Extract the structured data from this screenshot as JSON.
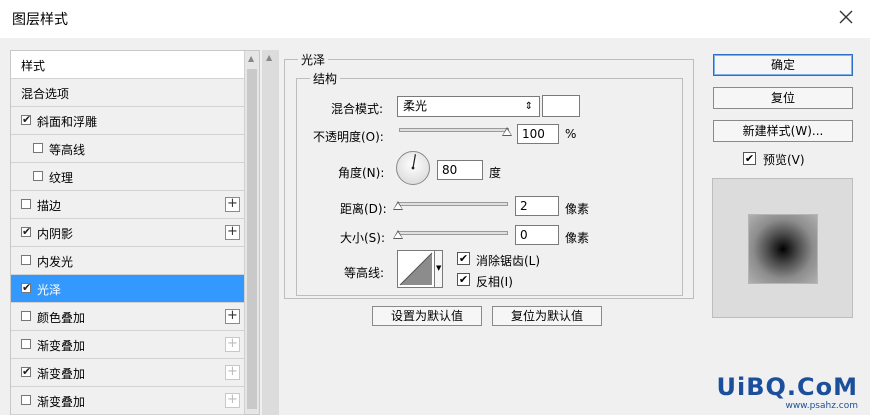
{
  "window": {
    "title": "图层样式"
  },
  "style_list": {
    "items": [
      {
        "label": "样式",
        "checkbox": false,
        "checked": false,
        "plus": "none",
        "indent": false,
        "selected": false
      },
      {
        "label": "混合选项",
        "checkbox": false,
        "checked": false,
        "plus": "none",
        "indent": false,
        "selected": false
      },
      {
        "label": "斜面和浮雕",
        "checkbox": true,
        "checked": true,
        "plus": "none",
        "indent": false,
        "selected": false
      },
      {
        "label": "等高线",
        "checkbox": true,
        "checked": false,
        "plus": "none",
        "indent": true,
        "selected": false
      },
      {
        "label": "纹理",
        "checkbox": true,
        "checked": false,
        "plus": "none",
        "indent": true,
        "selected": false
      },
      {
        "label": "描边",
        "checkbox": true,
        "checked": false,
        "plus": "active",
        "indent": false,
        "selected": false
      },
      {
        "label": "内阴影",
        "checkbox": true,
        "checked": true,
        "plus": "active",
        "indent": false,
        "selected": false
      },
      {
        "label": "内发光",
        "checkbox": true,
        "checked": false,
        "plus": "none",
        "indent": false,
        "selected": false
      },
      {
        "label": "光泽",
        "checkbox": true,
        "checked": true,
        "plus": "none",
        "indent": false,
        "selected": true
      },
      {
        "label": "颜色叠加",
        "checkbox": true,
        "checked": false,
        "plus": "active",
        "indent": false,
        "selected": false
      },
      {
        "label": "渐变叠加",
        "checkbox": true,
        "checked": false,
        "plus": "dim",
        "indent": false,
        "selected": false
      },
      {
        "label": "渐变叠加",
        "checkbox": true,
        "checked": true,
        "plus": "dim",
        "indent": false,
        "selected": false
      },
      {
        "label": "渐变叠加",
        "checkbox": true,
        "checked": false,
        "plus": "dim",
        "indent": false,
        "selected": false
      }
    ]
  },
  "satin": {
    "group_title": "光泽",
    "structure_title": "结构",
    "blend_mode": {
      "label": "混合模式:",
      "value": "柔光",
      "color": "#ffffff"
    },
    "opacity": {
      "label": "不透明度(O):",
      "value": "100",
      "unit": "%",
      "level": 1.0
    },
    "angle": {
      "label": "角度(N):",
      "value": "80",
      "unit": "度",
      "degrees": 80
    },
    "distance": {
      "label": "距离(D):",
      "value": "2",
      "unit": "像素",
      "level": 0.0
    },
    "size": {
      "label": "大小(S):",
      "value": "0",
      "unit": "像素",
      "level": 0.0
    },
    "contour": {
      "label": "等高线:",
      "anti_alias": {
        "label": "消除锯齿(L)",
        "checked": true
      },
      "invert": {
        "label": "反相(I)",
        "checked": true
      }
    },
    "buttons": {
      "set_default": "设置为默认值",
      "reset_default": "复位为默认值"
    }
  },
  "actions": {
    "ok": "确定",
    "reset": "复位",
    "new_style": "新建样式(W)...",
    "preview": {
      "label": "预览(V)",
      "checked": true
    }
  },
  "watermark": {
    "text": "UiBQ.CoM",
    "sub": "www.psahz.com"
  }
}
